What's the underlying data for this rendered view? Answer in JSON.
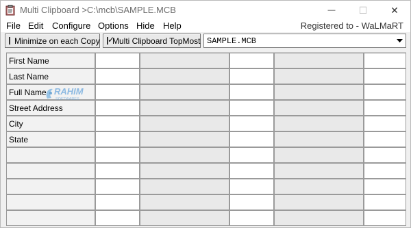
{
  "window": {
    "title": "Multi Clipboard >C:\\mcb\\SAMPLE.MCB",
    "controls": {
      "minimize": "—",
      "maximize": "☐",
      "close": "✕"
    }
  },
  "menu": {
    "items": [
      "File",
      "Edit",
      "Configure",
      "Options",
      "Hide",
      "Help"
    ],
    "registered": "Registered to - WaLMaRT"
  },
  "toolbar": {
    "minimize_on_copy": {
      "label": "Minimize on each Copy",
      "checked": false
    },
    "topmost": {
      "label": "Multi Clipboard TopMost",
      "checked": true,
      "check_glyph": "✓"
    },
    "file_select": {
      "value": "SAMPLE.MCB"
    }
  },
  "watermark": {
    "text": "RAHIM",
    "sub": "SOFTWARES"
  },
  "grid": {
    "rows": [
      {
        "label": "First Name"
      },
      {
        "label": "Last Name"
      },
      {
        "label": "Full Name"
      },
      {
        "label": "Street Address"
      },
      {
        "label": "City"
      },
      {
        "label": "State"
      },
      {
        "label": ""
      },
      {
        "label": ""
      },
      {
        "label": ""
      },
      {
        "label": ""
      },
      {
        "label": ""
      }
    ]
  },
  "colors": {
    "title_text": "#6d6d6d",
    "grid_label_bg": "#f2f2f2",
    "grid_value_bg": "#ffffff"
  }
}
